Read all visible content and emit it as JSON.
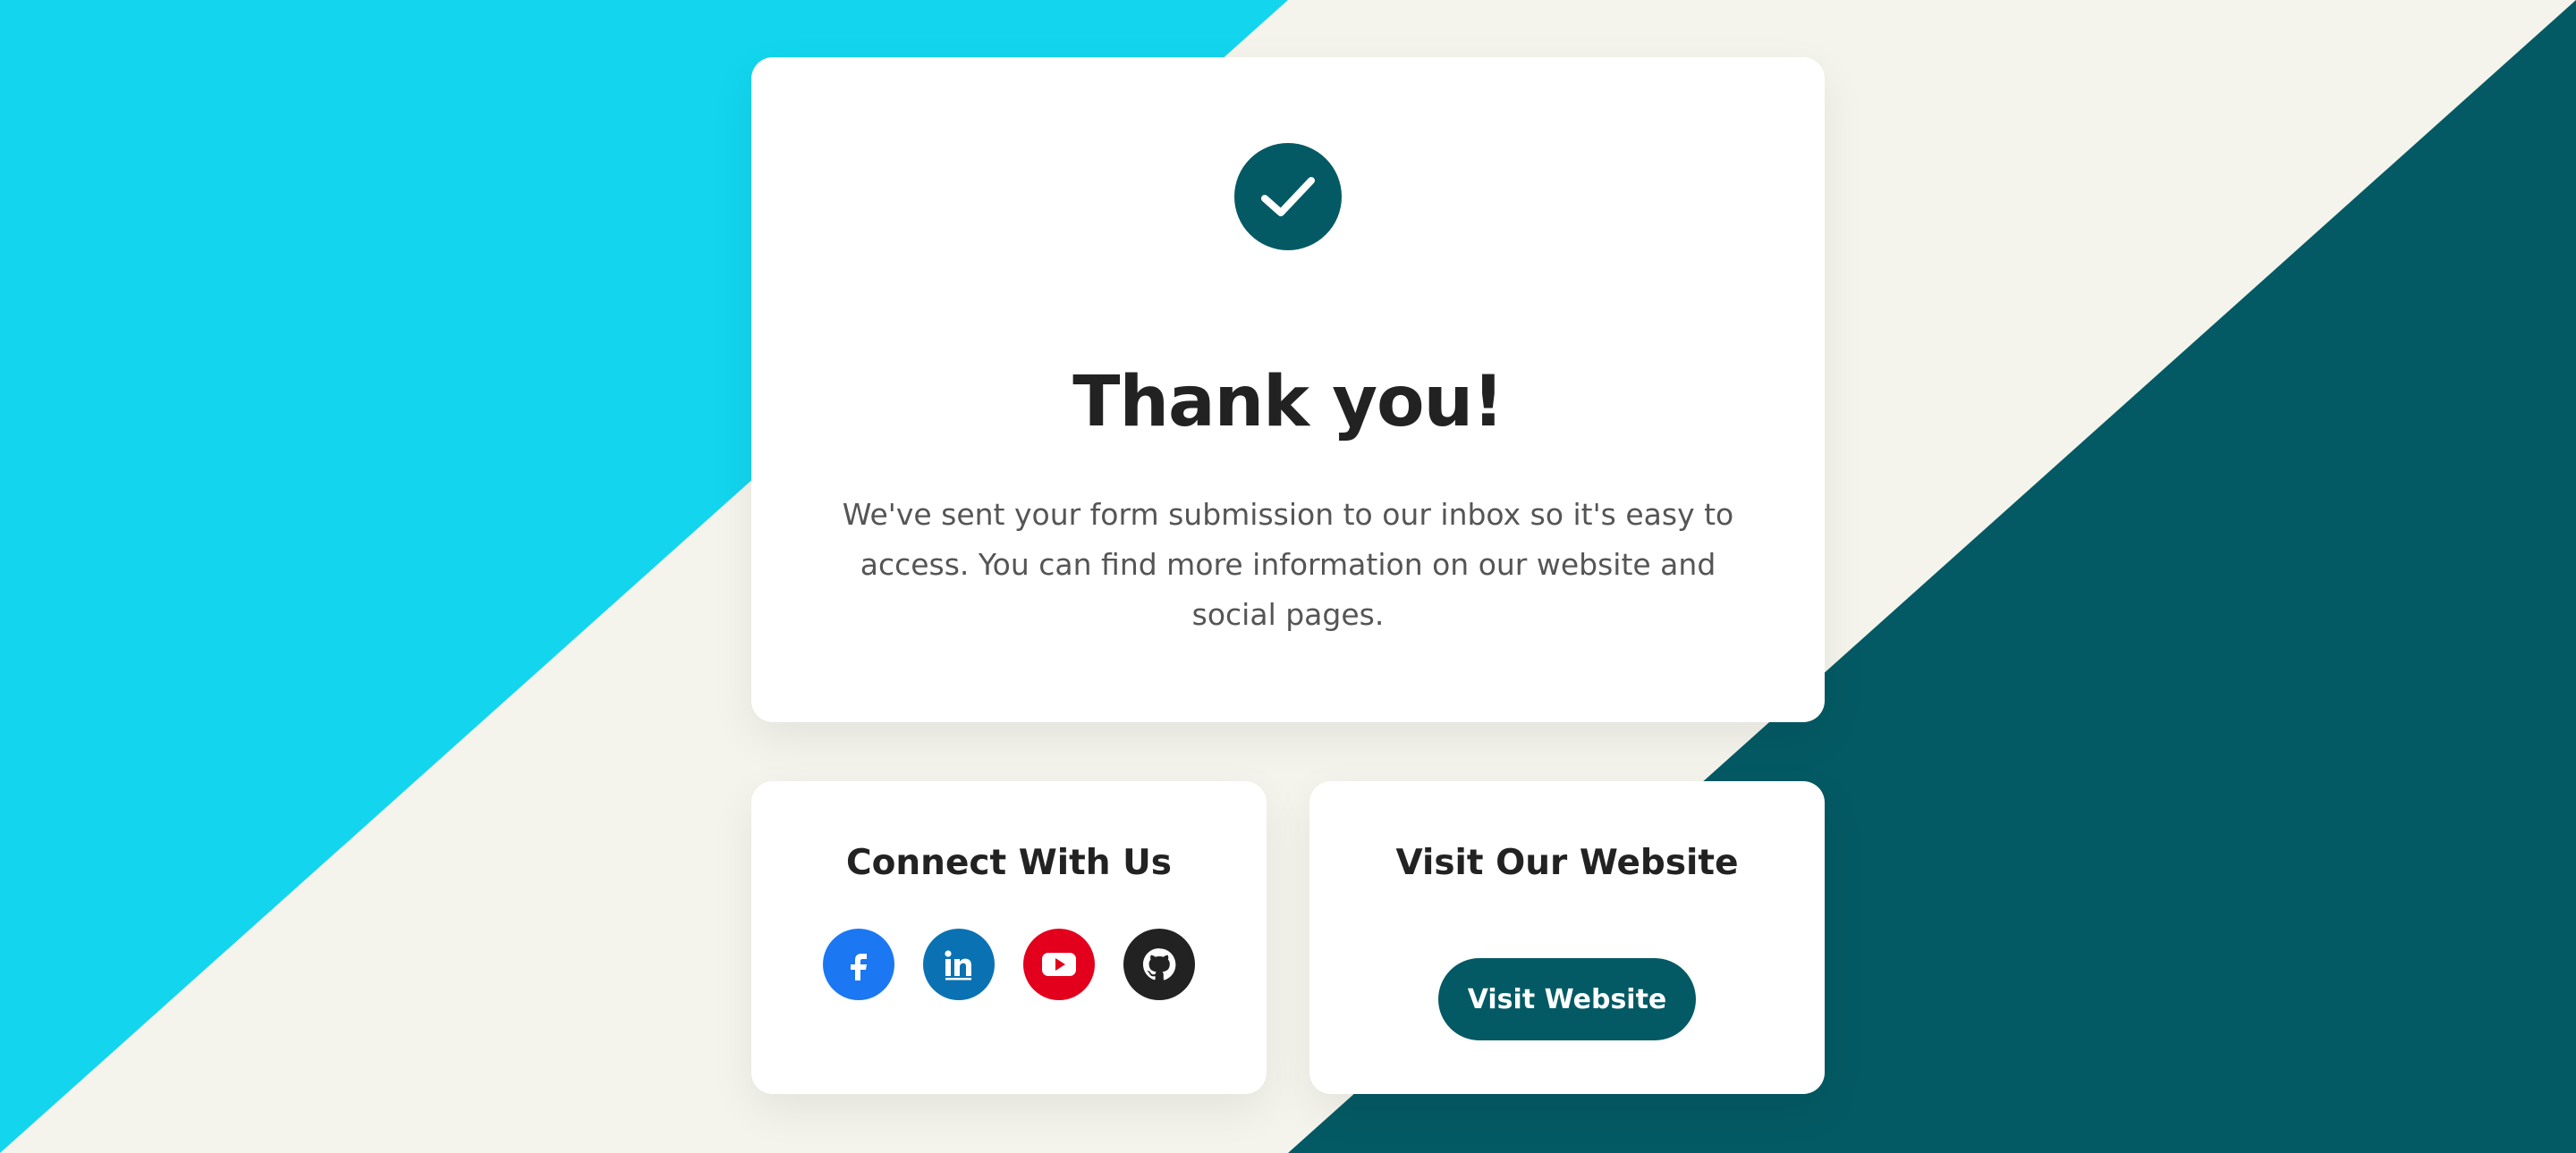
{
  "theme": {
    "accent_cyan": "#13d5ee",
    "accent_teal": "#045a64",
    "background": "#f4f4ec",
    "card": "#ffffff"
  },
  "confirmation": {
    "icon": "checkmark-icon",
    "title": "Thank you!",
    "message": "We've sent your form submission to our inbox so it's easy to access. You can find more information on our website and social pages."
  },
  "connect": {
    "title": "Connect With Us",
    "socials": [
      {
        "name": "facebook-icon",
        "color": "#1b77f2"
      },
      {
        "name": "linkedin-icon",
        "color": "#0a72b2"
      },
      {
        "name": "youtube-icon",
        "color": "#e2001d"
      },
      {
        "name": "github-icon",
        "color": "#222222"
      }
    ]
  },
  "visit": {
    "title": "Visit Our Website",
    "button_label": "Visit Website"
  }
}
